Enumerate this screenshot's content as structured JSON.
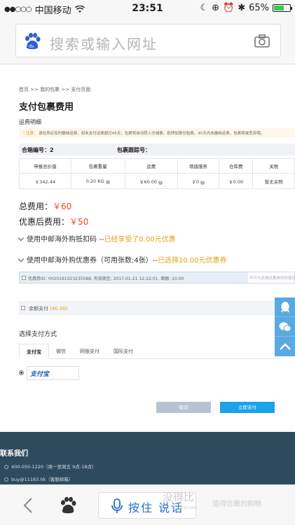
{
  "status_bar": {
    "carrier": "中国移动",
    "time": "23:51",
    "battery": "65%",
    "battery_level": 0.65
  },
  "browser": {
    "search_placeholder": "搜索或输入网址"
  },
  "page": {
    "breadcrumb": "首页 >> 我的包裹 >> 支付页面",
    "title": "支付包裹费用",
    "section_label": "运费明细",
    "notice_prefix": "! 注意：",
    "notice_text": "请在务必及时缴纳运费，如未支付运费超过45天，包裹将自动转入仓储费，抵押加算仓租费。45天内未缴纳运费，包裹将被丢弃哦。",
    "order_no_label": "合箱编号：2",
    "track_no_label": "包裹跟踪号：",
    "table": {
      "headers": [
        "申报总价值",
        "包裹重量",
        "运费",
        "增值服务",
        "仓库费",
        "关税"
      ],
      "row": [
        "￥342.44",
        "0.20 KG",
        "￥60.00",
        "￥0",
        "￥0.00",
        "暂无关税"
      ]
    },
    "total_label": "总费用：",
    "total_value": "￥60",
    "discount_label": "优惠后费用：",
    "discount_value": "￥50",
    "coupon_code_line": "使用中邮海外购抵扣码 --",
    "coupon_code_status": "已经享受了0.00元优惠",
    "coupon_line": "使用中邮海外购优惠券（可用张数:4张）--",
    "coupon_status": "已选择10.00元优惠券",
    "coupon_detail": "优惠券ID: YH20161023235588, 有效期至: 2017-01-21 12:22:01, 面额: 10.00",
    "coupon_right": "不可与其他优惠券同时使用",
    "balance_label": "余额支付",
    "balance_value": "(¥0.00)",
    "pay_method_title": "选择支付方式",
    "tabs": [
      "支付宝",
      "微信",
      "网银支付",
      "国际支付"
    ],
    "alipay_logo": "支付宝",
    "cancel_label": "取消",
    "submit_label": "立即支付"
  },
  "footer": {
    "heading": "联系我们",
    "phone": "400-050-1220（周一至周五 9点-18点）",
    "email": "buy@11183.hk（客服邮箱）"
  },
  "bottom_bar": {
    "voice_label": "按住 说话",
    "watermark": "没得比",
    "watermark_tag": "值得信赖的购物",
    "watermark_url": "meidebi.com"
  }
}
